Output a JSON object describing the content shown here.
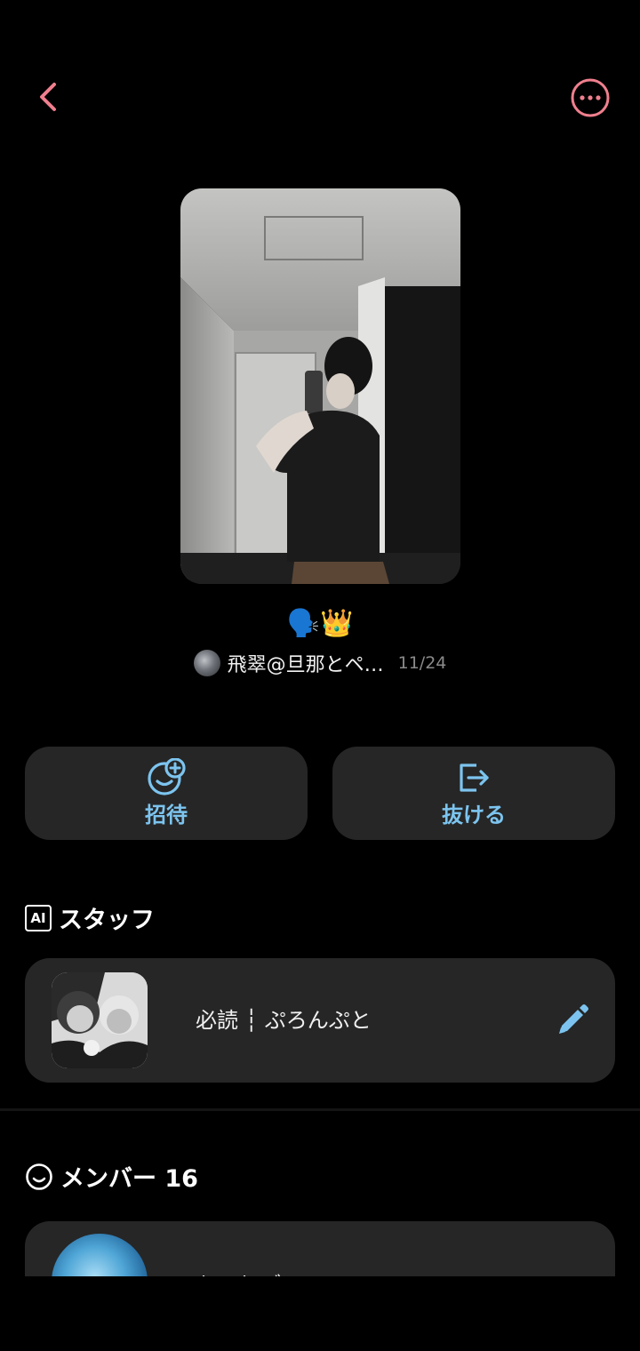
{
  "header": {
    "back_icon": "chevron-left-icon",
    "more_icon": "more-horizontal-icon",
    "accent_color": "#f07f8e"
  },
  "room": {
    "emojis": "🗣️👑",
    "owner_name": "飛翠@旦那とペ…",
    "date": "11/24"
  },
  "actions": {
    "invite_label": "招待",
    "invite_icon": "smiley-plus-icon",
    "leave_label": "抜ける",
    "leave_icon": "exit-icon",
    "accent_color": "#7cc4ef"
  },
  "staff": {
    "badge": "AI",
    "title": "スタッフ",
    "item_name": "必読 ┆ ぷろんぷと",
    "edit_icon": "pencil-icon"
  },
  "members": {
    "title": "メンバー 16",
    "first_member_name": "ちゃりデン"
  }
}
